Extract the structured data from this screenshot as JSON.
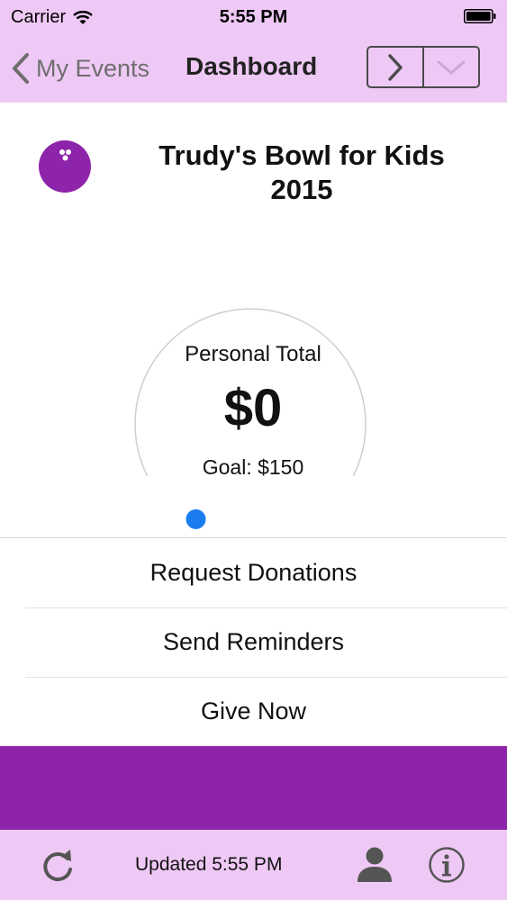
{
  "status_bar": {
    "carrier": "Carrier",
    "time": "5:55 PM"
  },
  "nav": {
    "back_label": "My Events",
    "title": "Dashboard",
    "next_icon": "chevron-right-icon",
    "dropdown_icon": "chevron-down-icon"
  },
  "event": {
    "title": "Trudy's Bowl for Kids 2015",
    "icon": "bowling-ball-icon"
  },
  "gauge": {
    "label": "Personal Total",
    "value": "$0",
    "goal": "Goal: $150",
    "progress_percent": 0
  },
  "actions": [
    {
      "label": "Request Donations"
    },
    {
      "label": "Send Reminders"
    },
    {
      "label": "Give Now"
    }
  ],
  "toolbar": {
    "updated": "Updated 5:55 PM",
    "refresh_icon": "refresh-icon",
    "profile_icon": "profile-icon",
    "info_icon": "info-icon"
  },
  "colors": {
    "bar_background": "#efc9f5",
    "accent": "#8e24aa",
    "gauge_dot": "#1a7cf0"
  }
}
